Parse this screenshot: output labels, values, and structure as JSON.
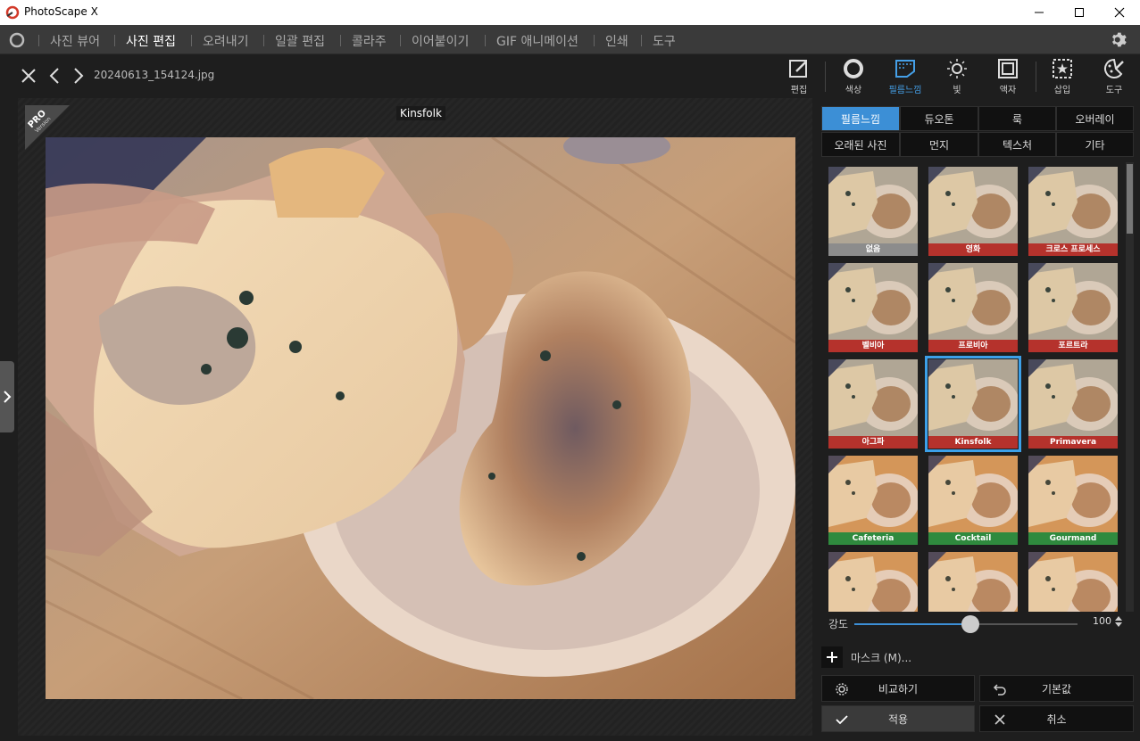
{
  "window": {
    "title": "PhotoScape X"
  },
  "menu": {
    "items": [
      {
        "label": "사진 뷰어",
        "active": false
      },
      {
        "label": "사진 편집",
        "active": true
      },
      {
        "label": "오려내기",
        "active": false
      },
      {
        "label": "일괄 편집",
        "active": false
      },
      {
        "label": "콜라주",
        "active": false
      },
      {
        "label": "이어붙이기",
        "active": false
      },
      {
        "label": "GIF 애니메이션",
        "active": false
      },
      {
        "label": "인쇄",
        "active": false
      },
      {
        "label": "도구",
        "active": false
      }
    ]
  },
  "toolbar": {
    "filename": "20240613_154124.jpg",
    "tools": [
      {
        "label": "편집",
        "icon": "edit-icon"
      },
      {
        "label": "색상",
        "icon": "color-icon"
      },
      {
        "label": "필름느낌",
        "icon": "film-icon",
        "active": true
      },
      {
        "label": "빛",
        "icon": "light-icon"
      },
      {
        "label": "액자",
        "icon": "frame-icon"
      },
      {
        "label": "삽입",
        "icon": "insert-icon"
      },
      {
        "label": "도구",
        "icon": "tools-icon"
      }
    ]
  },
  "canvas": {
    "badge_main": "PRO",
    "badge_sub": "Version",
    "current_filter": "Kinsfolk"
  },
  "panel": {
    "tabs": [
      {
        "label": "필름느낌",
        "active": true
      },
      {
        "label": "듀오톤"
      },
      {
        "label": "룩"
      },
      {
        "label": "오버레이"
      },
      {
        "label": "오래된 사진"
      },
      {
        "label": "먼지"
      },
      {
        "label": "텍스처"
      },
      {
        "label": "기타"
      }
    ],
    "filters": [
      {
        "label": "없음",
        "color": "#8c8c8c"
      },
      {
        "label": "영화",
        "color": "#b5322c"
      },
      {
        "label": "크로스 프로세스",
        "color": "#b5322c"
      },
      {
        "label": "벨비아",
        "color": "#b5322c"
      },
      {
        "label": "프로비아",
        "color": "#b5322c"
      },
      {
        "label": "포르트라",
        "color": "#b5322c"
      },
      {
        "label": "아그파",
        "color": "#b5322c"
      },
      {
        "label": "Kinsfolk",
        "color": "#b5322c",
        "selected": true
      },
      {
        "label": "Primavera",
        "color": "#b5322c"
      },
      {
        "label": "Cafeteria",
        "color": "#2f8a3e"
      },
      {
        "label": "Cocktail",
        "color": "#2f8a3e"
      },
      {
        "label": "Gourmand",
        "color": "#2f8a3e"
      },
      {
        "label": "",
        "color": "#2f8a3e"
      },
      {
        "label": "",
        "color": "#2f8a3e"
      },
      {
        "label": "",
        "color": "#2f8a3e"
      }
    ],
    "strength_label": "강도",
    "strength_value": "100",
    "strength_fraction": 0.52,
    "mask_label": "마스크 (M)...",
    "buttons": {
      "compare": "비교하기",
      "default": "기본값",
      "apply": "적용",
      "cancel": "취소"
    }
  },
  "colors": {
    "accent": "#3c8fd6",
    "selected_outline": "#3ca0e8"
  }
}
